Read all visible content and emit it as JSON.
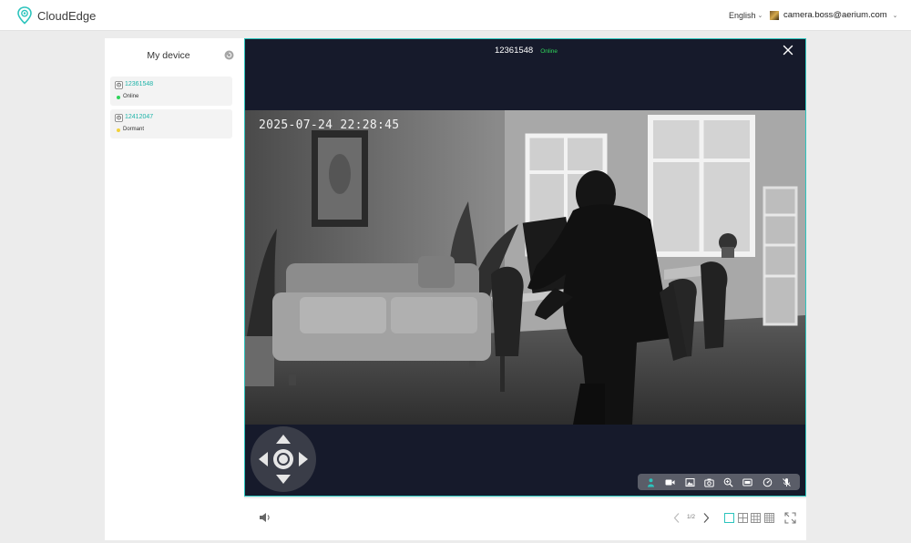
{
  "app": {
    "name": "CloudEdge"
  },
  "header": {
    "language": "English",
    "user_email": "camera.boss@aerium.com"
  },
  "sidebar": {
    "title": "My device",
    "devices": [
      {
        "id": "12361548",
        "status": "Online",
        "status_color": "#2fd45a",
        "selected": true
      },
      {
        "id": "12412047",
        "status": "Dormant",
        "status_color": "#f2d13a",
        "selected": false
      }
    ]
  },
  "player": {
    "device_id": "12361548",
    "status": "Online",
    "timestamp": "2025-07-24  22:28:45",
    "toolbar_icons": [
      "ptz-person-icon",
      "record-icon",
      "gallery-icon",
      "snapshot-icon",
      "zoom-icon",
      "hd-icon",
      "speed-icon",
      "mic-off-icon"
    ]
  },
  "controls": {
    "page": "1/2",
    "layouts": [
      "1x1-layout-icon",
      "2x2-layout-icon",
      "3x3-layout-icon",
      "4x4-layout-icon"
    ]
  },
  "colors": {
    "accent": "#2cc4bd",
    "online": "#2fd45a",
    "dormant": "#f2d13a",
    "video_bg": "#161a2b"
  }
}
